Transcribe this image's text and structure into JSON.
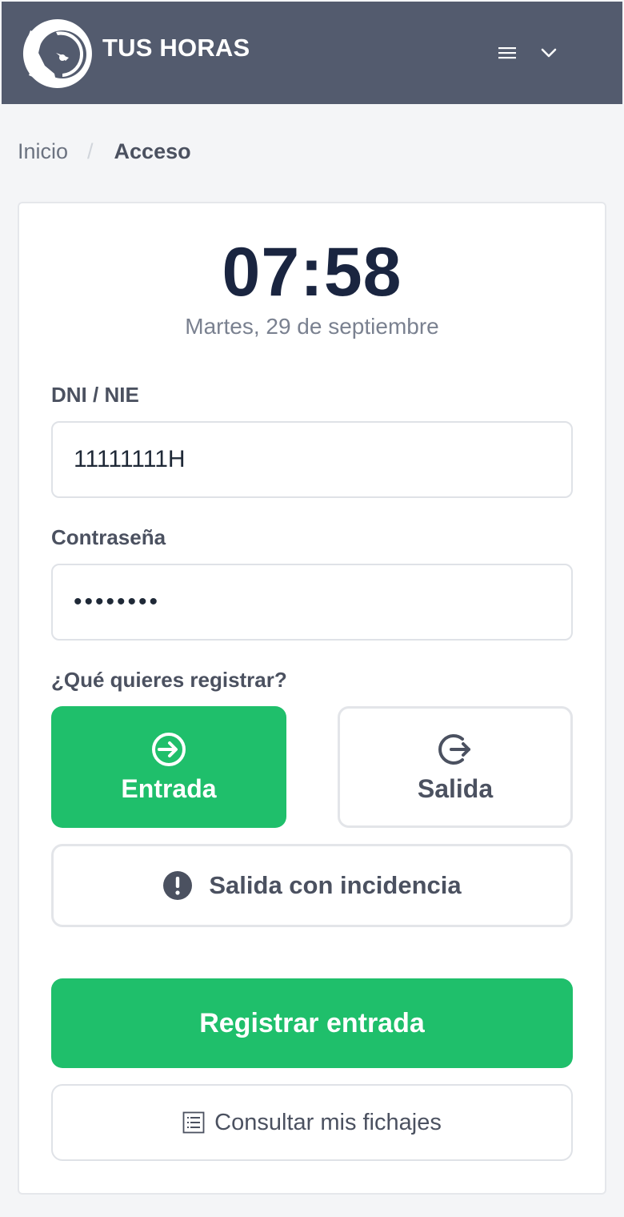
{
  "header": {
    "brand": "TUS HORAS",
    "icons": {
      "logo": "clock-gear-logo",
      "menu": "hamburger-icon",
      "dropdown": "chevron-down-icon"
    }
  },
  "breadcrumb": {
    "home": "Inicio",
    "separator": "/",
    "current": "Acceso"
  },
  "clock": {
    "time": "07:58",
    "date": "Martes, 29 de septiembre"
  },
  "form": {
    "dni_label": "DNI / NIE",
    "dni_value": "11111111H",
    "password_label": "Contraseña",
    "password_value": "••••••••",
    "question": "¿Qué quieres registrar?",
    "options": {
      "entrada": {
        "label": "Entrada",
        "icon": "arrow-right-circle-icon",
        "selected": true
      },
      "salida": {
        "label": "Salida",
        "icon": "logout-circle-icon",
        "selected": false
      },
      "incidencia": {
        "label": "Salida con incidencia",
        "icon": "exclamation-circle-icon",
        "selected": false
      }
    },
    "submit_label": "Registrar entrada",
    "consult_label": "Consultar mis fichajes",
    "consult_icon": "list-icon"
  },
  "colors": {
    "header_bg": "#535b6e",
    "accent_green": "#1fbf6b",
    "clock_text": "#1a2540"
  }
}
